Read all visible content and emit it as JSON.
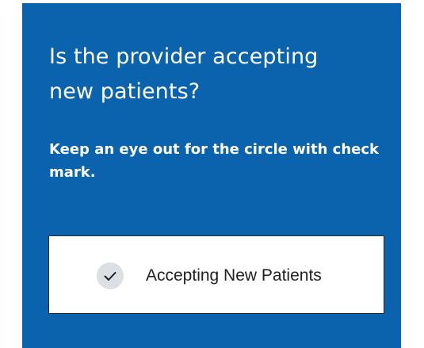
{
  "panel": {
    "heading": "Is the provider accepting new patients?",
    "subtext": "Keep an eye out for the circle with check mark.",
    "example": {
      "icon": "check-circle-icon",
      "label": "Accepting New Patients"
    }
  },
  "colors": {
    "panel_background": "#0b63ad",
    "panel_text": "#ffffff",
    "card_background": "#ffffff",
    "check_circle_fill": "#dcdfe3",
    "check_mark": "#1f1f1f"
  }
}
